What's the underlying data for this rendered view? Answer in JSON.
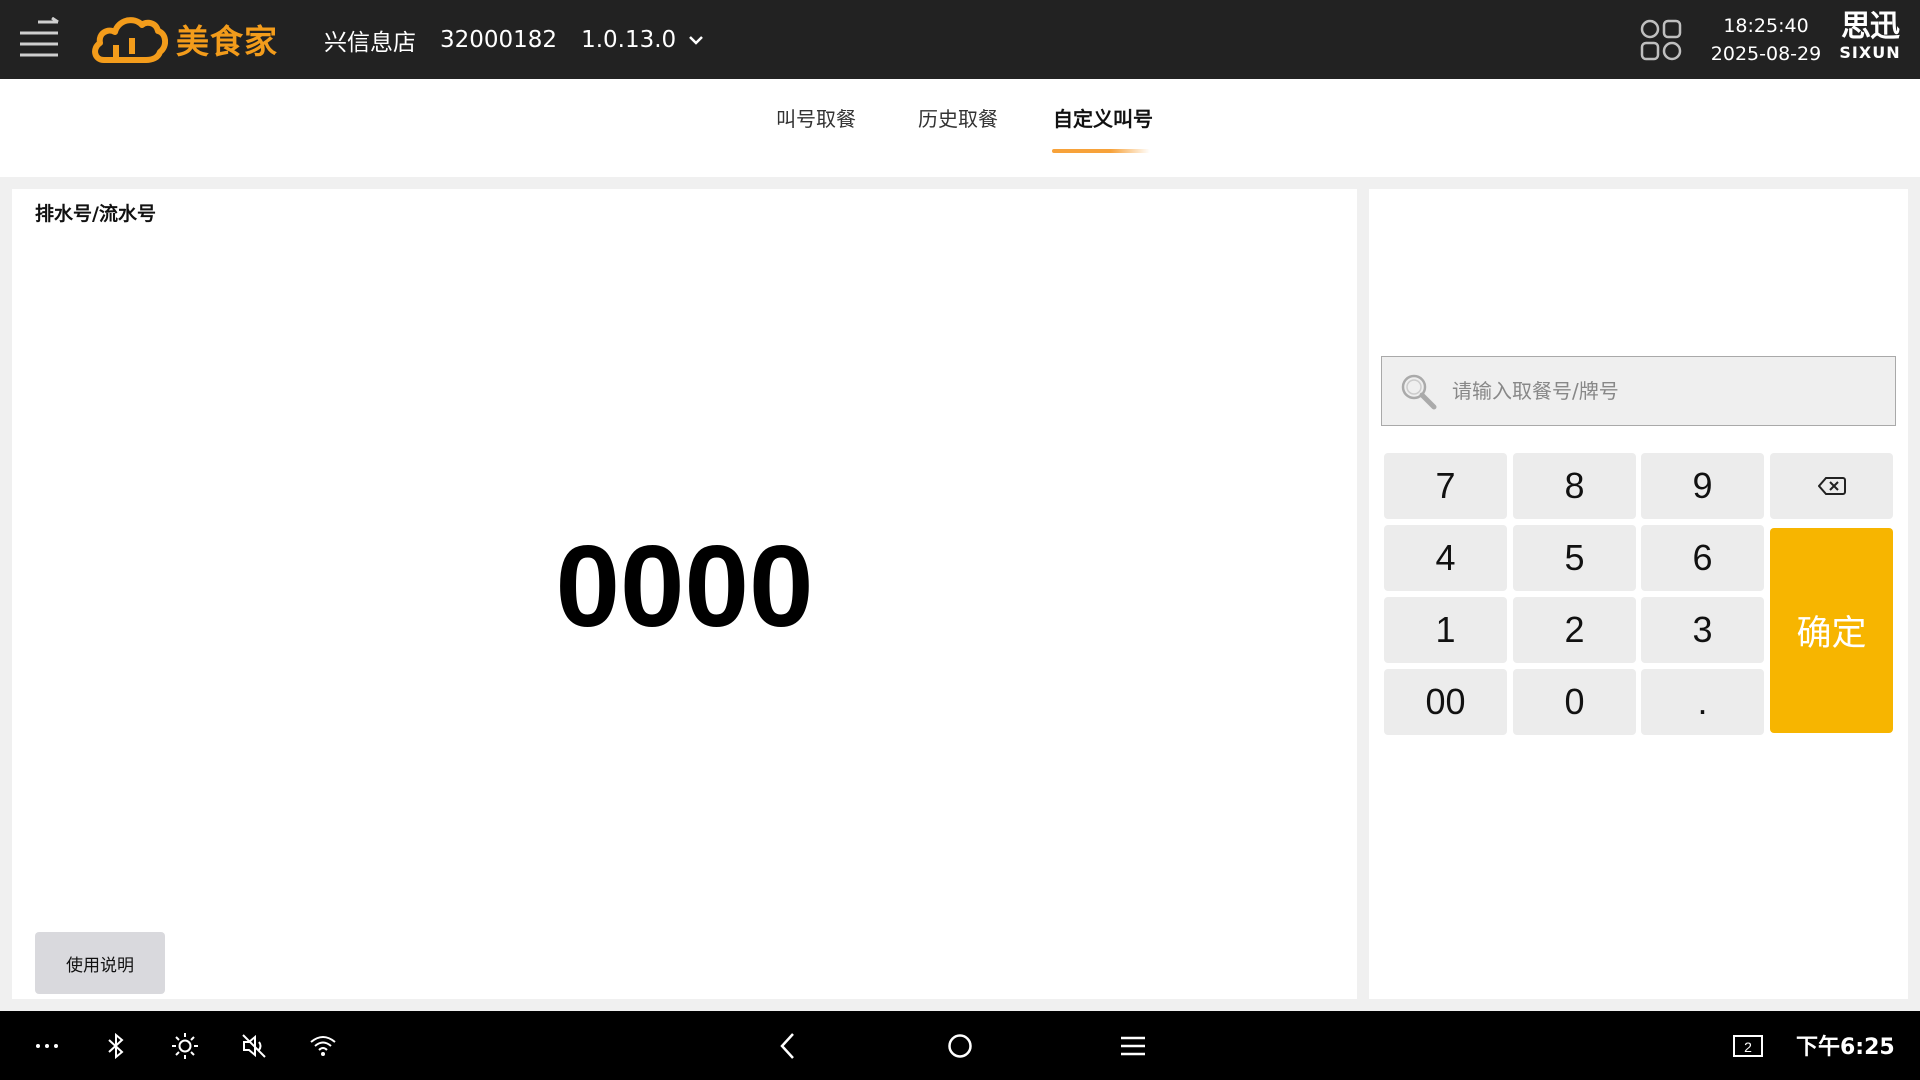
{
  "header": {
    "brand_name": "美食家",
    "store_name": "兴信息店",
    "store_id": "32000182",
    "version": "1.0.13.0",
    "time": "18:25:40",
    "date": "2025-08-29",
    "vendor_cn": "思迅",
    "vendor_en": "SIXUN",
    "accent_color": "#f39c1b"
  },
  "tabs": [
    {
      "label": "叫号取餐",
      "active": false
    },
    {
      "label": "历史取餐",
      "active": false
    },
    {
      "label": "自定义叫号",
      "active": true
    }
  ],
  "left_panel": {
    "label": "排水号/流水号",
    "number": "0000",
    "help_label": "使用说明"
  },
  "right_panel": {
    "search_placeholder": "请输入取餐号/牌号",
    "keys": {
      "k7": "7",
      "k8": "8",
      "k9": "9",
      "k4": "4",
      "k5": "5",
      "k6": "6",
      "k1": "1",
      "k2": "2",
      "k3": "3",
      "k00": "00",
      "k0": "0",
      "kdot": "."
    },
    "confirm_label": "确定",
    "confirm_color": "#f7b500"
  },
  "system_bar": {
    "time": "下午6:25",
    "screen_badge": "2",
    "icons": [
      "more-icon",
      "bluetooth-icon",
      "brightness-icon",
      "volume-mute-icon",
      "wifi-icon",
      "back-icon",
      "home-icon",
      "recent-apps-icon",
      "screen-icon"
    ]
  }
}
